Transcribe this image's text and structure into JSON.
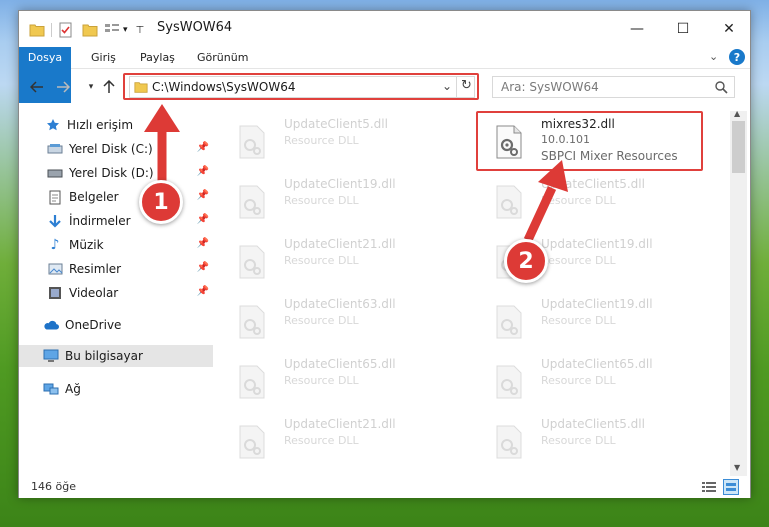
{
  "window": {
    "title": "SysWOW64",
    "minimize": "—",
    "maximize": "☐",
    "close": "✕"
  },
  "ribbon": {
    "tabs": [
      "Dosya",
      "Giriş",
      "Paylaş",
      "Görünüm"
    ]
  },
  "address": {
    "path": "C:\\Windows\\SysWOW64",
    "search_placeholder": "Ara: SysWOW64"
  },
  "nav": {
    "items": [
      {
        "label": "Hızlı erişim",
        "icon": "star-icon"
      },
      {
        "label": "Yerel Disk (C:)",
        "icon": "drive-icon",
        "pinned": true
      },
      {
        "label": "Yerel Disk (D:)",
        "icon": "drive-icon",
        "pinned": true
      },
      {
        "label": "Belgeler",
        "icon": "documents-icon",
        "pinned": true
      },
      {
        "label": "İndirmeler",
        "icon": "download-icon",
        "pinned": true
      },
      {
        "label": "Müzik",
        "icon": "music-icon",
        "pinned": true
      },
      {
        "label": "Resimler",
        "icon": "pictures-icon",
        "pinned": true
      },
      {
        "label": "Videolar",
        "icon": "videos-icon",
        "pinned": true
      },
      {
        "label": "OneDrive",
        "icon": "cloud-icon"
      },
      {
        "label": "Bu bilgisayar",
        "icon": "computer-icon",
        "selected": true
      },
      {
        "label": "Ağ",
        "icon": "network-icon"
      }
    ]
  },
  "files": {
    "left": [
      {
        "name": "UpdateClient5.dll",
        "desc": "Resource DLL"
      },
      {
        "name": "UpdateClient19.dll",
        "desc": "Resource DLL"
      },
      {
        "name": "UpdateClient21.dll",
        "desc": "Resource DLL"
      },
      {
        "name": "UpdateClient63.dll",
        "desc": "Resource DLL"
      },
      {
        "name": "UpdateClient65.dll",
        "desc": "Resource DLL"
      },
      {
        "name": "UpdateClient21.dll",
        "desc": "Resource DLL"
      }
    ],
    "highlight": {
      "name": "mixres32.dll",
      "version": "10.0.101",
      "desc": "SBPCI Mixer Resources"
    },
    "right": [
      {
        "name": "UpdateClient5.dll",
        "desc": "Resource DLL"
      },
      {
        "name": "UpdateClient19.dll",
        "desc": "Resource DLL"
      },
      {
        "name": "UpdateClient19.dll",
        "desc": "Resource DLL"
      },
      {
        "name": "UpdateClient65.dll",
        "desc": "Resource DLL"
      },
      {
        "name": "UpdateClient5.dll",
        "desc": "Resource DLL"
      }
    ]
  },
  "status": {
    "count": "146 öğe"
  },
  "callouts": {
    "one": "1",
    "two": "2"
  },
  "colors": {
    "accent": "#1979ca",
    "callout": "#dd3a36"
  }
}
